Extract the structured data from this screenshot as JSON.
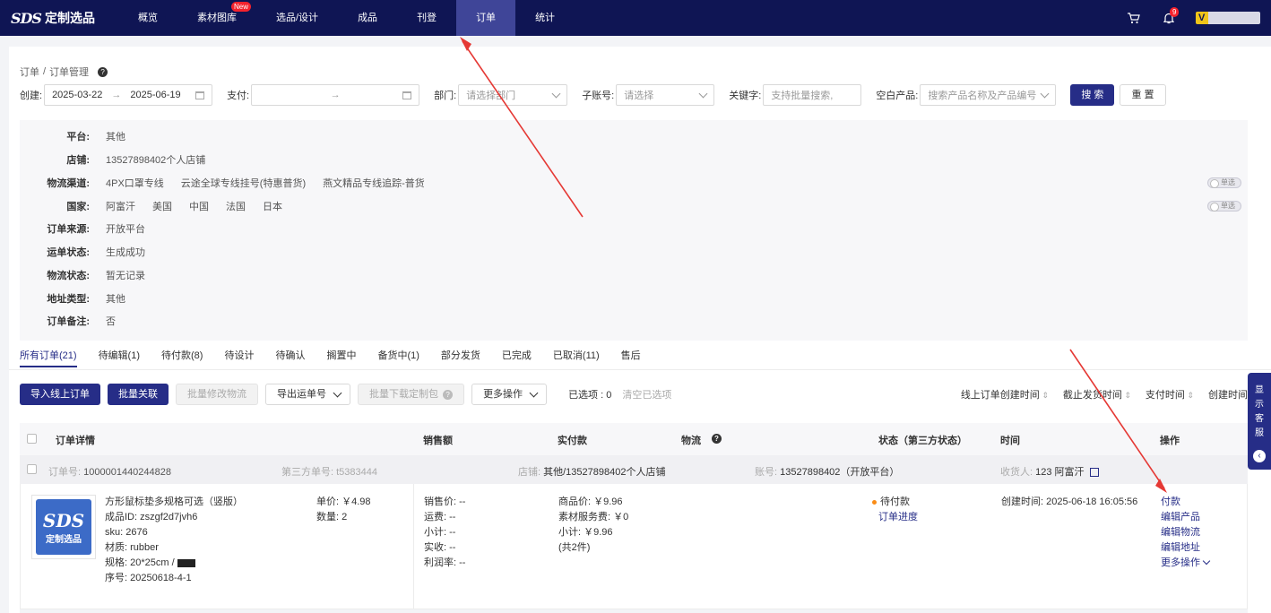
{
  "nav": {
    "logo_mark": "SDS",
    "logo_text": "定制选品",
    "items": [
      "概览",
      "素材图库",
      "选品/设计",
      "成品",
      "刊登",
      "订单",
      "统计"
    ],
    "new_badge": "New",
    "notification_count": "9",
    "user_initial": "V"
  },
  "breadcrumb": {
    "root": "订单",
    "sep": "/",
    "current": "订单管理",
    "help": "?"
  },
  "filters": {
    "create_label": "创建:",
    "create_start": "2025-03-22",
    "create_end": "2025-06-19",
    "pay_label": "支付:",
    "range_arrow": "→",
    "dept_label": "部门:",
    "dept_placeholder": "请选择部门",
    "subaccount_label": "子账号:",
    "subaccount_placeholder": "请选择",
    "keyword_label": "关键字:",
    "keyword_placeholder": "支持批量搜索,",
    "blank_label": "空白产品:",
    "blank_placeholder": "搜索产品名称及产品编号",
    "search_btn": "搜 索",
    "reset_btn": "重 置"
  },
  "facets": [
    {
      "label": "平台:",
      "values": [
        "其他"
      ]
    },
    {
      "label": "店铺:",
      "values": [
        "13527898402个人店铺"
      ]
    },
    {
      "label": "物流渠道:",
      "values": [
        "4PX口罩专线",
        "云途全球专线挂号(特惠普货)",
        "燕文精品专线追踪-普货"
      ],
      "toggle": "单选"
    },
    {
      "label": "国家:",
      "values": [
        "阿富汗",
        "美国",
        "中国",
        "法国",
        "日本"
      ],
      "toggle": "单选"
    },
    {
      "label": "订单来源:",
      "values": [
        "开放平台"
      ]
    },
    {
      "label": "运单状态:",
      "values": [
        "生成成功"
      ]
    },
    {
      "label": "物流状态:",
      "values": [
        "暂无记录"
      ]
    },
    {
      "label": "地址类型:",
      "values": [
        "其他"
      ]
    },
    {
      "label": "订单备注:",
      "values": [
        "否"
      ]
    }
  ],
  "tabs": [
    "所有订单(21)",
    "待编辑(1)",
    "待付款(8)",
    "待设计",
    "待确认",
    "搁置中",
    "备货中(1)",
    "部分发货",
    "已完成",
    "已取消(11)",
    "售后"
  ],
  "actions": {
    "import": "导入线上订单",
    "batch_link": "批量关联",
    "batch_edit_logistics": "批量修改物流",
    "export_waybill": "导出运单号",
    "batch_download": "批量下载定制包",
    "more_ops": "更多操作",
    "selected": "已选项 : 0",
    "clear": "清空已选项"
  },
  "sorts": [
    "线上订单创建时间",
    "截止发货时间",
    "支付时间",
    "创建时间"
  ],
  "table_headers": {
    "detail": "订单详情",
    "sales": "销售额",
    "paid": "实付款",
    "logistics": "物流",
    "status": "状态（第三方状态）",
    "time": "时间",
    "ops": "操作"
  },
  "order": {
    "order_no_label": "订单号:",
    "order_no": "1000001440244828",
    "third_no_label": "第三方单号:",
    "third_no": "t5383444",
    "shop_label": "店铺:",
    "shop": "其他/13527898402个人店铺",
    "account_label": "账号:",
    "account": "13527898402（开放平台）",
    "receiver_label": "收货人:",
    "receiver": "123 阿富汗",
    "thumb_mark": "SDS",
    "thumb_text": "定制选品",
    "product_name": "方形鼠标垫多规格可选（竖版）",
    "product_id": "成品ID: zszgf2d7jvh6",
    "sku": "sku: 2676",
    "material": "材质: rubber",
    "spec": "规格: 20*25cm /",
    "serial": "序号: 20250618-4-1",
    "unit_price": "单价: ￥4.98",
    "quantity": "数量: 2",
    "sales_lines": [
      "销售价: --",
      "运费: --",
      "小计: --",
      "实收: --",
      "利润率: --"
    ],
    "paid_lines": [
      "商品价: ￥9.96",
      "素材服务费: ￥0",
      "小计: ￥9.96",
      "(共2件)"
    ],
    "status": "待付款",
    "status_link": "订单进度",
    "created_time": "创建时间: 2025-06-18 16:05:56",
    "ops": [
      "付款",
      "编辑产品",
      "编辑物流",
      "编辑地址",
      "更多操作"
    ]
  },
  "side_service": {
    "label": "显示客服"
  }
}
